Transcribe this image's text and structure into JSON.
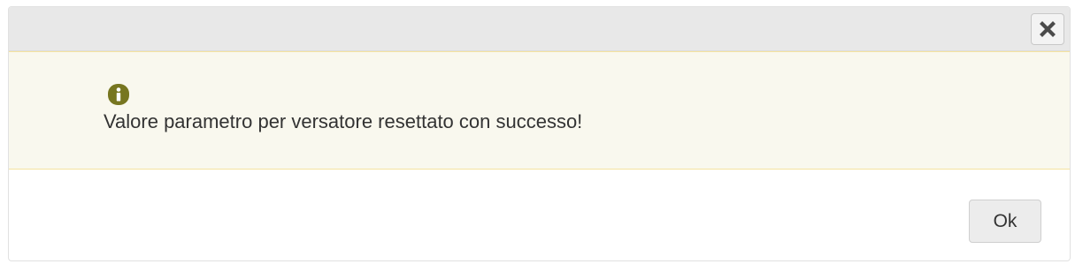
{
  "dialog": {
    "message": "Valore parametro per versatore resettato con successo!",
    "ok_label": "Ok",
    "close_icon": "close-icon",
    "info_icon": "info-icon"
  },
  "colors": {
    "titlebar": "#e8e8e8",
    "message_background": "#f9f8ee",
    "message_border": "#f5e3a0",
    "info_icon": "#777620",
    "text": "#333333"
  }
}
